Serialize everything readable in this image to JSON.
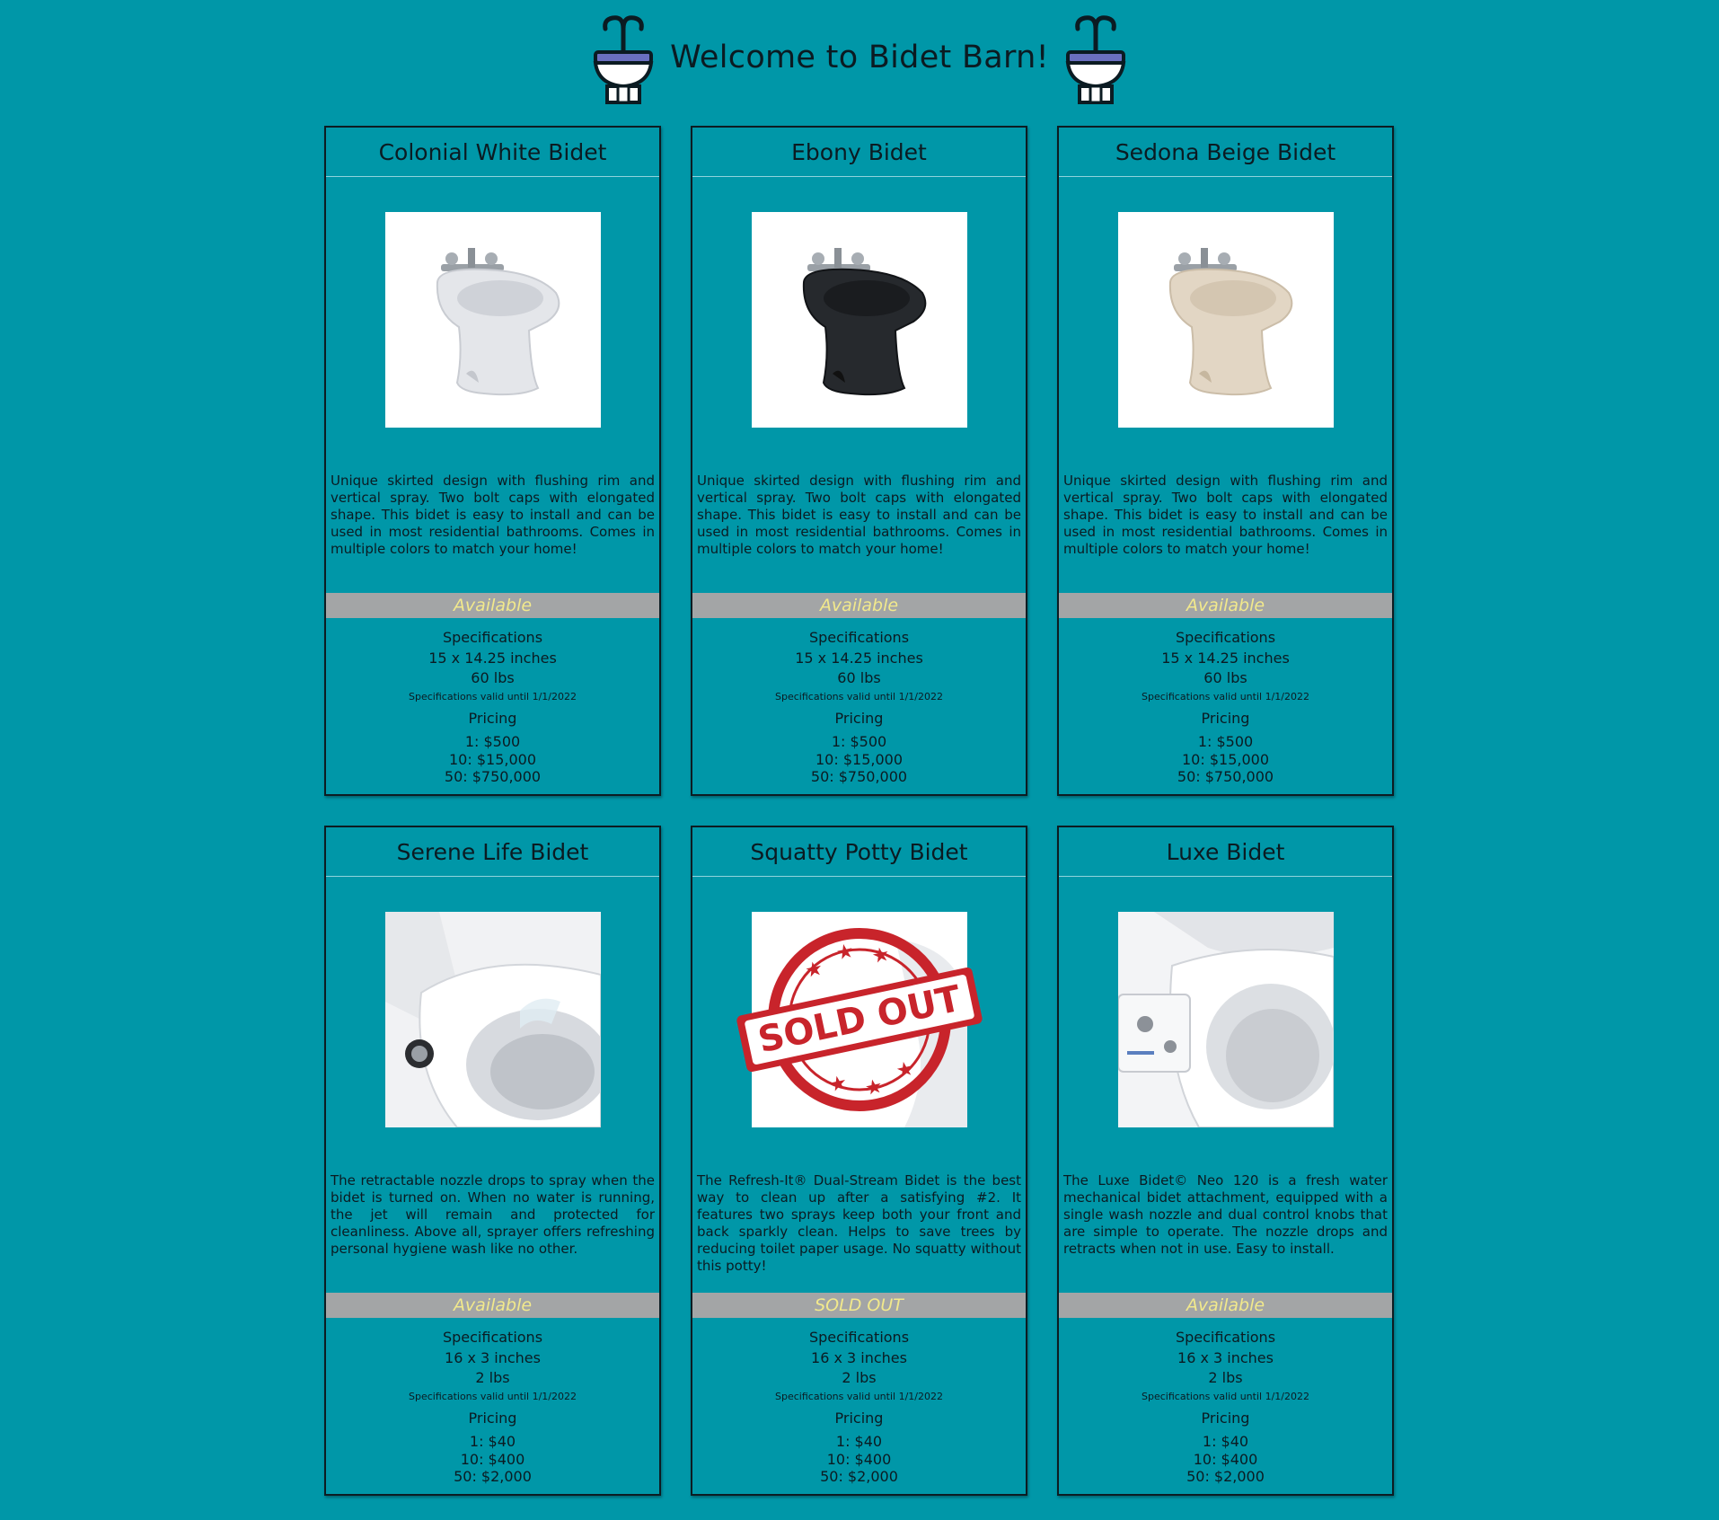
{
  "header": {
    "title": "Welcome to Bidet Barn!"
  },
  "labels": {
    "specifications": "Specifications",
    "specs_valid": "Specifications valid until 1/1/2022",
    "pricing": "Pricing"
  },
  "colors": {
    "background": "#0097a8",
    "status_bar": "#a3a5a6",
    "status_text": "#f2e98c",
    "sold_out_stamp": "#c8242b"
  },
  "products": [
    {
      "name": "Colonial White Bidet",
      "image": "white-bidet-image",
      "description": "Unique skirted design with flushing rim and vertical spray. Two bolt caps with elongated shape. This bidet is easy to install and can be used in most residential bathrooms. Comes in multiple colors to match your home!",
      "status": "Available",
      "dimensions": "15 x 14.25 inches",
      "weight": "60 lbs",
      "prices": [
        "1: $500",
        "10: $15,000",
        "50: $750,000"
      ]
    },
    {
      "name": "Ebony Bidet",
      "image": "black-bidet-image",
      "description": "Unique skirted design with flushing rim and vertical spray. Two bolt caps with elongated shape. This bidet is easy to install and can be used in most residential bathrooms. Comes in multiple colors to match your home!",
      "status": "Available",
      "dimensions": "15 x 14.25 inches",
      "weight": "60 lbs",
      "prices": [
        "1: $500",
        "10: $15,000",
        "50: $750,000"
      ]
    },
    {
      "name": "Sedona Beige Bidet",
      "image": "beige-bidet-image",
      "description": "Unique skirted design with flushing rim and vertical spray. Two bolt caps with elongated shape. This bidet is easy to install and can be used in most residential bathrooms. Comes in multiple colors to match your home!",
      "status": "Available",
      "dimensions": "15 x 14.25 inches",
      "weight": "60 lbs",
      "prices": [
        "1: $500",
        "10: $15,000",
        "50: $750,000"
      ]
    },
    {
      "name": "Serene Life Bidet",
      "image": "bidet-seat-image",
      "description": "The retractable nozzle drops to spray when the bidet is turned on. When no water is running, the jet will remain and protected for cleanliness. Above all, sprayer offers refreshing personal hygiene wash like no other.",
      "status": "Available",
      "dimensions": "16 x 3 inches",
      "weight": "2 lbs",
      "prices": [
        "1: $40",
        "10: $400",
        "50: $2,000"
      ]
    },
    {
      "name": "Squatty Potty Bidet",
      "image": "sold-out-stamp-image",
      "stamp_text": "SOLD OUT",
      "description": "The Refresh-It® Dual-Stream Bidet is the best way to clean up after a satisfying #2. It features two sprays keep both your front and back sparkly clean. Helps to save trees by reducing toilet paper usage. No squatty without this potty!",
      "status": "SOLD OUT",
      "dimensions": "16 x 3 inches",
      "weight": "2 lbs",
      "prices": [
        "1: $40",
        "10: $400",
        "50: $2,000"
      ]
    },
    {
      "name": "Luxe Bidet",
      "image": "bidet-attachment-image",
      "description": "The Luxe Bidet© Neo 120 is a fresh water mechanical bidet attachment, equipped with a single wash nozzle and dual control knobs that are simple to operate. The nozzle drops and retracts when not in use. Easy to install.",
      "status": "Available",
      "dimensions": "16 x 3 inches",
      "weight": "2 lbs",
      "prices": [
        "1: $40",
        "10: $400",
        "50: $2,000"
      ]
    }
  ]
}
